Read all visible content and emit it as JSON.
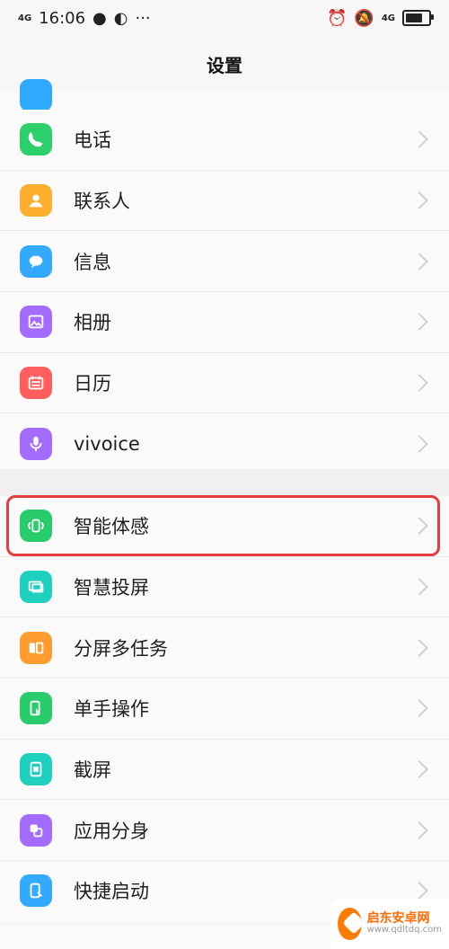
{
  "statusbar": {
    "signal_label": "4G",
    "time": "16:06",
    "more": "···",
    "right_signal": "4G"
  },
  "header": {
    "title": "设置"
  },
  "group1": {
    "items": [
      {
        "label": "电话",
        "icon": "phone-icon",
        "color": "#2bd06a"
      },
      {
        "label": "联系人",
        "icon": "contacts-icon",
        "color": "#ffae2e"
      },
      {
        "label": "信息",
        "icon": "message-icon",
        "color": "#33a9ff"
      },
      {
        "label": "相册",
        "icon": "album-icon",
        "color": "#a46bff"
      },
      {
        "label": "日历",
        "icon": "calendar-icon",
        "color": "#ff5e5e"
      },
      {
        "label": "vivoice",
        "icon": "microphone-icon",
        "color": "#a46bff"
      }
    ]
  },
  "group2": {
    "items": [
      {
        "label": "智能体感",
        "icon": "motion-sense-icon",
        "color": "#29cc6a"
      },
      {
        "label": "智慧投屏",
        "icon": "screen-cast-icon",
        "color": "#1fcfbf"
      },
      {
        "label": "分屏多任务",
        "icon": "split-screen-icon",
        "color": "#ff9b2f"
      },
      {
        "label": "单手操作",
        "icon": "one-hand-icon",
        "color": "#29cc6a"
      },
      {
        "label": "截屏",
        "icon": "screenshot-icon",
        "color": "#1fcfbf"
      },
      {
        "label": "应用分身",
        "icon": "app-clone-icon",
        "color": "#a46bff"
      },
      {
        "label": "快捷启动",
        "icon": "quick-launch-icon",
        "color": "#33a9ff"
      }
    ]
  },
  "watermark": {
    "title": "启东安卓网",
    "url": "www.qdltdq.com"
  }
}
